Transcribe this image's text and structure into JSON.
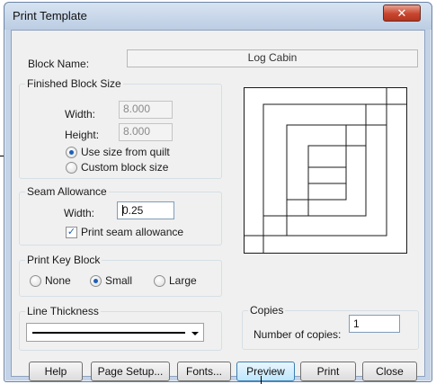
{
  "window": {
    "title": "Print Template",
    "close_glyph": "✕"
  },
  "block_name": {
    "label": "Block Name:",
    "value": "Log Cabin"
  },
  "finished_size": {
    "title": "Finished Block Size",
    "width_label": "Width:",
    "width_value": "8.000",
    "height_label": "Height:",
    "height_value": "8.000",
    "options": [
      "Use size from quilt",
      "Custom block size"
    ],
    "selected": 0
  },
  "seam": {
    "title": "Seam Allowance",
    "width_label": "Width:",
    "width_value": "0.25",
    "print_label": "Print seam allowance",
    "print_checked": true
  },
  "key_block": {
    "title": "Print Key Block",
    "options": [
      "None",
      "Small",
      "Large"
    ],
    "selected": 1
  },
  "line_thickness": {
    "title": "Line Thickness"
  },
  "copies": {
    "title": "Copies",
    "label": "Number of copies:",
    "value": "1"
  },
  "buttons": {
    "help": "Help",
    "page_setup": "Page Setup...",
    "fonts": "Fonts...",
    "preview": "Preview",
    "print": "Print",
    "close": "Close"
  },
  "colors": {
    "accent": "#1d5fb8",
    "frame": "#c4d3e6",
    "close_red": "#c8462f"
  },
  "icons": {
    "check": "✓"
  }
}
